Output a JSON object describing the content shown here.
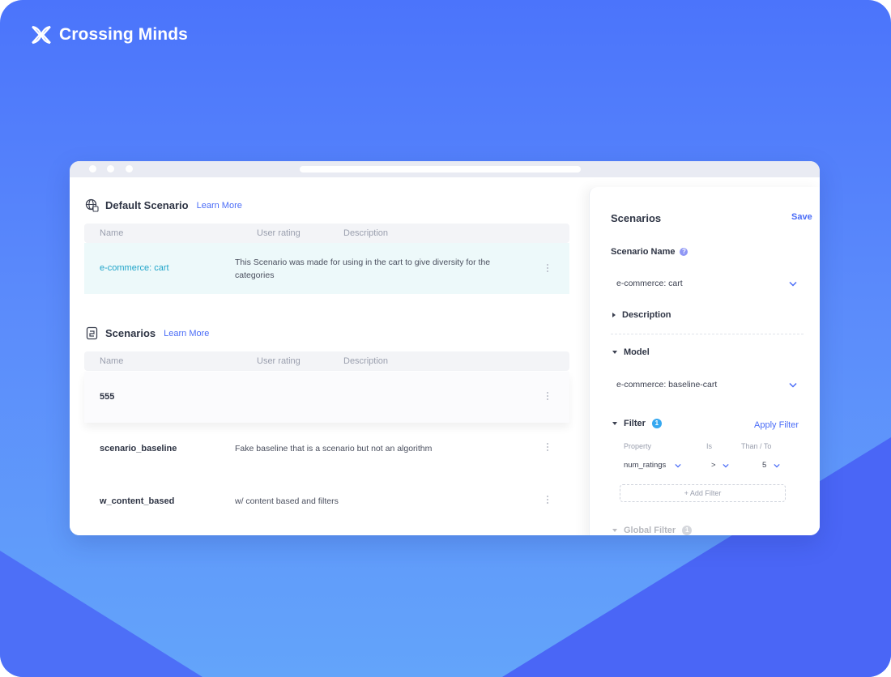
{
  "brand": {
    "name": "Crossing Minds"
  },
  "colors": {
    "accent": "#4a6cf7",
    "highlight_row": "#edf9fa",
    "link_teal": "#1fa4c9",
    "badge": "#36a8f0"
  },
  "default_scenario": {
    "title": "Default Scenario",
    "learn_more": "Learn More",
    "columns": [
      "Name",
      "User rating",
      "Description"
    ],
    "row": {
      "name": "e-commerce: cart",
      "description": "This Scenario was made for using in the cart to give diversity for the categories"
    }
  },
  "scenarios": {
    "title": "Scenarios",
    "learn_more": "Learn More",
    "columns": [
      "Name",
      "User rating",
      "Description"
    ],
    "rows": [
      {
        "name": "555",
        "description": ""
      },
      {
        "name": "scenario_baseline",
        "description": "Fake baseline that is a scenario but not an algorithm"
      },
      {
        "name": "w_content_based",
        "description": "w/ content based and filters"
      }
    ]
  },
  "panel": {
    "title": "Scenarios",
    "save": "Save",
    "scenario_name_label": "Scenario Name",
    "scenario_name_value": "e-commerce: cart",
    "description_label": "Description",
    "model_label": "Model",
    "model_value": "e-commerce: baseline-cart",
    "filter_label": "Filter",
    "filter_count": "1",
    "apply_filter": "Apply Filter",
    "filter_headers": {
      "property": "Property",
      "is": "Is",
      "than": "Than / To"
    },
    "filter_row": {
      "property": "num_ratings",
      "operator": ">",
      "value": "5"
    },
    "add_filter": "+ Add Filter",
    "global_filter_label": "Global Filter",
    "global_filter_count": "1"
  }
}
